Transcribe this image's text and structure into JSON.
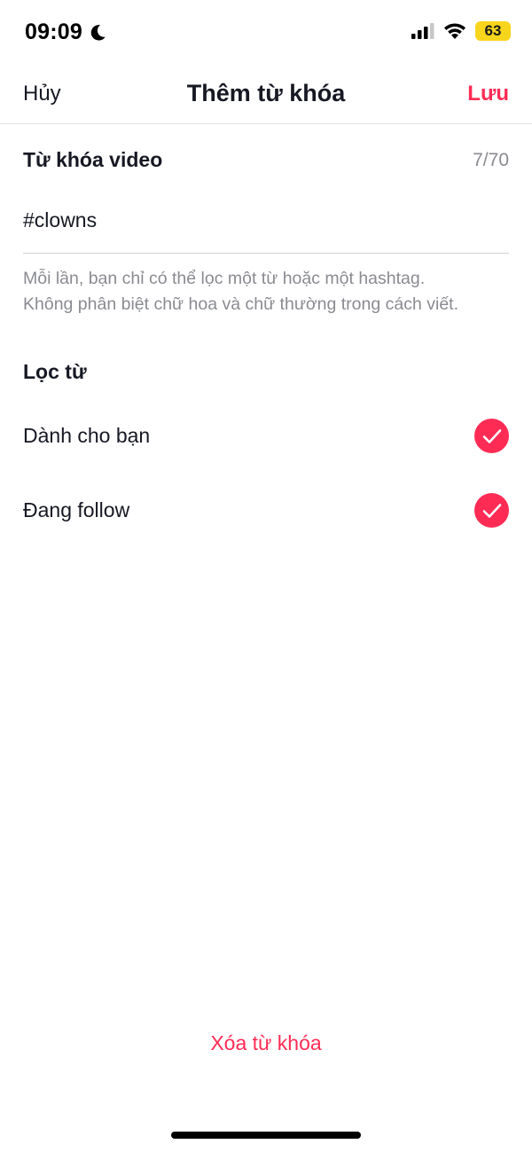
{
  "status_bar": {
    "time": "09:09",
    "battery": "63",
    "battery_color": "#f8d51d",
    "icons": [
      "moon-icon",
      "signal-icon",
      "wifi-icon",
      "battery-icon"
    ]
  },
  "nav": {
    "cancel_label": "Hủy",
    "title": "Thêm từ khóa",
    "save_label": "Lưu"
  },
  "keyword": {
    "label": "Từ khóa video",
    "count": "7/70",
    "value": "#clowns",
    "hint_line1": "Mỗi lần, bạn chỉ có thể lọc một từ hoặc một hashtag.",
    "hint_line2": "Không phân biệt chữ hoa và chữ thường trong cách viết."
  },
  "filter": {
    "title": "Lọc từ",
    "options": [
      {
        "label": "Dành cho bạn",
        "checked": true
      },
      {
        "label": "Đang follow",
        "checked": true
      }
    ]
  },
  "delete_label": "Xóa từ khóa",
  "colors": {
    "accent": "#fe2c55",
    "text": "#161823",
    "secondary_text": "#8a8b91"
  }
}
